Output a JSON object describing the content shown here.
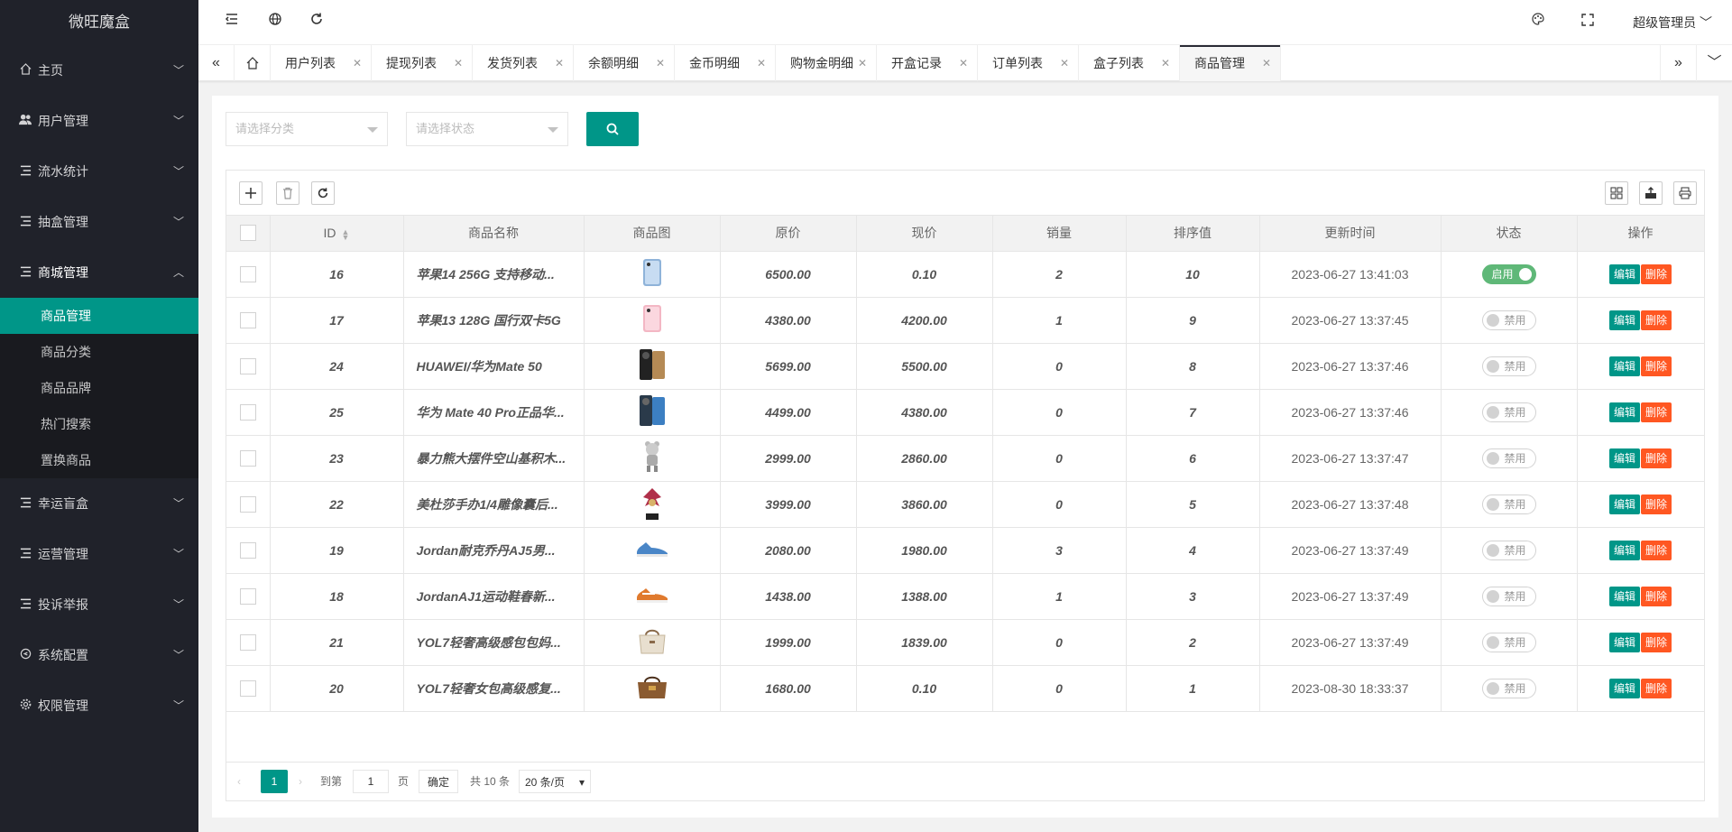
{
  "app_title": "微旺魔盒",
  "sidebar": {
    "items": [
      {
        "label": "主页",
        "icon": "home-icon"
      },
      {
        "label": "用户管理",
        "icon": "users-icon"
      },
      {
        "label": "流水统计",
        "icon": "list-icon"
      },
      {
        "label": "抽盒管理",
        "icon": "list-icon"
      },
      {
        "label": "商城管理",
        "icon": "list-icon"
      },
      {
        "label": "幸运盲盒",
        "icon": "list-icon"
      },
      {
        "label": "运营管理",
        "icon": "list-icon"
      },
      {
        "label": "投诉举报",
        "icon": "list-icon"
      },
      {
        "label": "系统配置",
        "icon": "settings-icon"
      },
      {
        "label": "权限管理",
        "icon": "gear-icon"
      }
    ],
    "sub_items": [
      "商品管理",
      "商品分类",
      "商品品牌",
      "热门搜索",
      "置换商品"
    ],
    "active_sub": "商品管理"
  },
  "header": {
    "user": "超级管理员"
  },
  "tabs": [
    "用户列表",
    "提现列表",
    "发货列表",
    "余额明细",
    "金币明细",
    "购物金明细",
    "开盒记录",
    "订单列表",
    "盒子列表",
    "商品管理"
  ],
  "active_tab": "商品管理",
  "search": {
    "category_placeholder": "请选择分类",
    "status_placeholder": "请选择状态"
  },
  "table": {
    "columns": [
      "ID",
      "商品名称",
      "商品图",
      "原价",
      "现价",
      "销量",
      "排序值",
      "更新时间",
      "状态",
      "操作"
    ],
    "rows": [
      {
        "id": "16",
        "name": "苹果14 256G 支持移动...",
        "price": "6500.00",
        "now": "0.10",
        "sales": "2",
        "sort": "10",
        "time": "2023-06-27 13:41:03",
        "status": "启用",
        "on": true,
        "img": "phone-blue"
      },
      {
        "id": "17",
        "name": "苹果13 128G 国行双卡5G",
        "price": "4380.00",
        "now": "4200.00",
        "sales": "1",
        "sort": "9",
        "time": "2023-06-27 13:37:45",
        "status": "禁用",
        "on": false,
        "img": "phone-pink"
      },
      {
        "id": "24",
        "name": "HUAWEI/华为Mate 50",
        "price": "5699.00",
        "now": "5500.00",
        "sales": "0",
        "sort": "8",
        "time": "2023-06-27 13:37:46",
        "status": "禁用",
        "on": false,
        "img": "phone-black"
      },
      {
        "id": "25",
        "name": "华为 Mate 40 Pro正品华...",
        "price": "4499.00",
        "now": "4380.00",
        "sales": "0",
        "sort": "7",
        "time": "2023-06-27 13:37:46",
        "status": "禁用",
        "on": false,
        "img": "phone-dark"
      },
      {
        "id": "23",
        "name": "暴力熊大摆件空山基积木...",
        "price": "2999.00",
        "now": "2860.00",
        "sales": "0",
        "sort": "6",
        "time": "2023-06-27 13:37:47",
        "status": "禁用",
        "on": false,
        "img": "figure-bear"
      },
      {
        "id": "22",
        "name": "美杜莎手办1/4雕像囊后...",
        "price": "3999.00",
        "now": "3860.00",
        "sales": "0",
        "sort": "5",
        "time": "2023-06-27 13:37:48",
        "status": "禁用",
        "on": false,
        "img": "figure-statue"
      },
      {
        "id": "19",
        "name": "Jordan耐克乔丹AJ5男...",
        "price": "2080.00",
        "now": "1980.00",
        "sales": "3",
        "sort": "4",
        "time": "2023-06-27 13:37:49",
        "status": "禁用",
        "on": false,
        "img": "shoe-blue"
      },
      {
        "id": "18",
        "name": "JordanAJ1运动鞋春新...",
        "price": "1438.00",
        "now": "1388.00",
        "sales": "1",
        "sort": "3",
        "time": "2023-06-27 13:37:49",
        "status": "禁用",
        "on": false,
        "img": "shoe-orange"
      },
      {
        "id": "21",
        "name": "YOL7轻奢高级感包包妈...",
        "price": "1999.00",
        "now": "1839.00",
        "sales": "0",
        "sort": "2",
        "time": "2023-06-27 13:37:49",
        "status": "禁用",
        "on": false,
        "img": "bag-white"
      },
      {
        "id": "20",
        "name": "YOL7轻奢女包高级感复...",
        "price": "1680.00",
        "now": "0.10",
        "sales": "0",
        "sort": "1",
        "time": "2023-08-30 18:33:37",
        "status": "禁用",
        "on": false,
        "img": "bag-brown"
      }
    ],
    "edit_label": "编辑",
    "delete_label": "删除"
  },
  "pager": {
    "current": "1",
    "goto_label": "到第",
    "page_input": "1",
    "page_unit": "页",
    "confirm_label": "确定",
    "total": "共 10 条",
    "limit": "20 条/页"
  }
}
